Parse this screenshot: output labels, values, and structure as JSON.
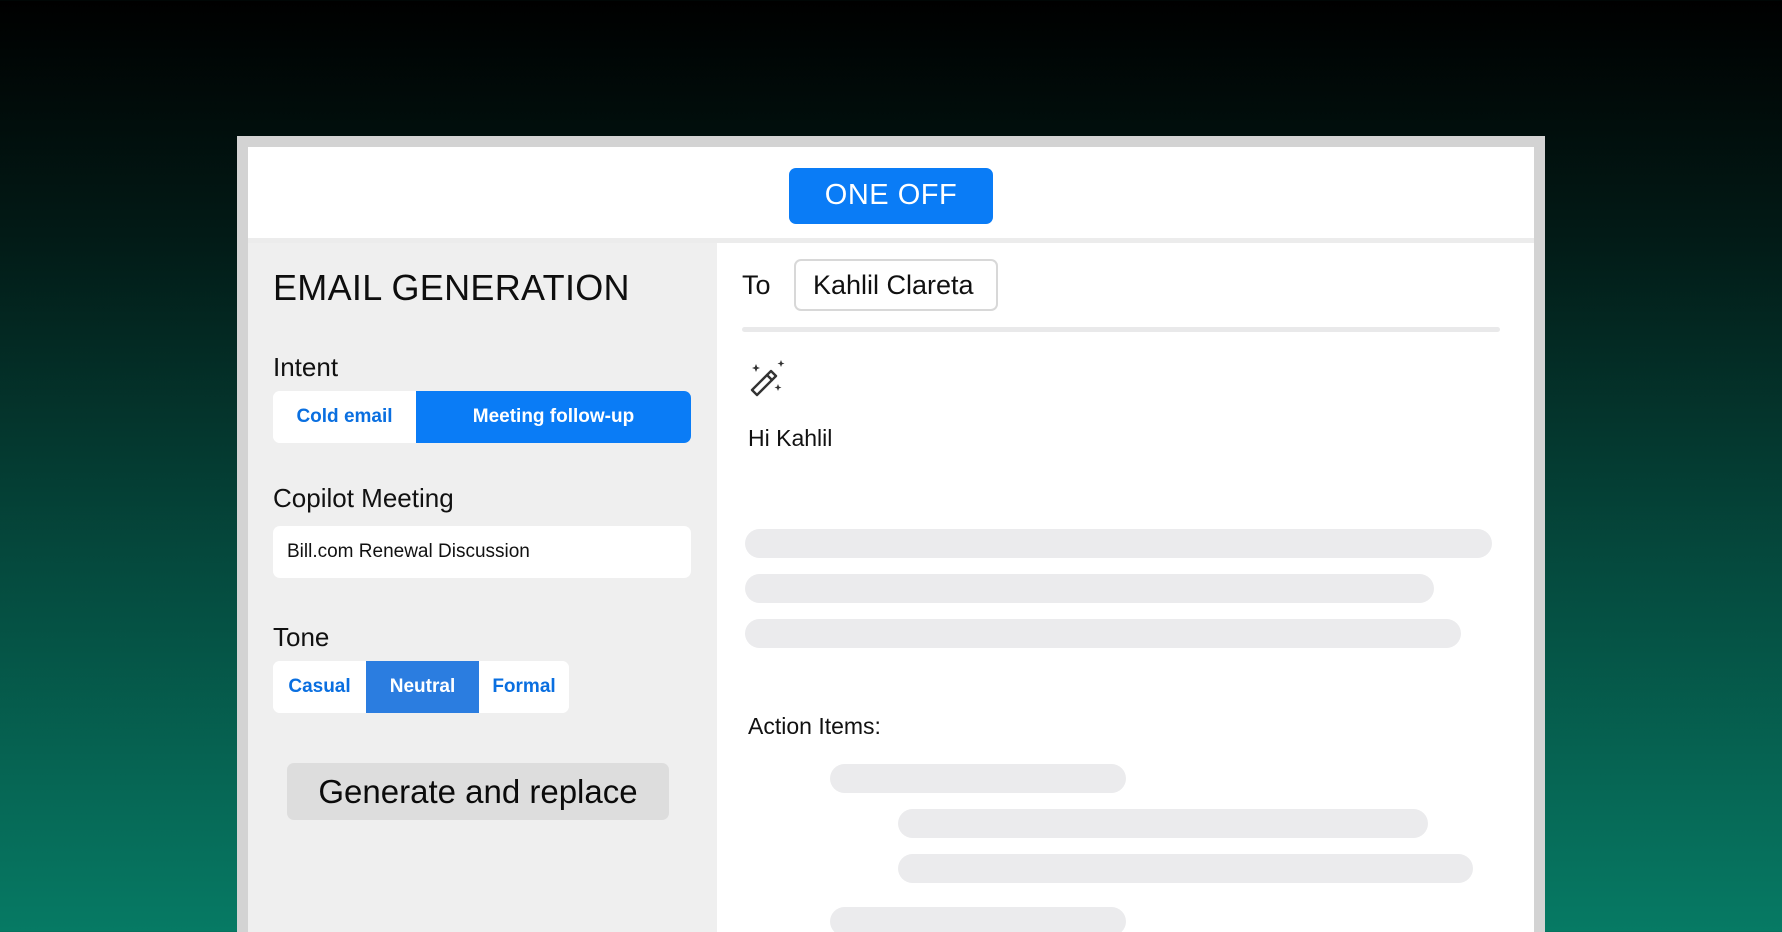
{
  "header": {
    "mode_label": "ONE OFF"
  },
  "left_panel": {
    "title": "EMAIL GENERATION",
    "intent": {
      "label": "Intent",
      "options": [
        "Cold email",
        "Meeting follow-up"
      ],
      "selected": "Meeting follow-up"
    },
    "meeting": {
      "label": "Copilot Meeting",
      "value": "Bill.com Renewal Discussion"
    },
    "tone": {
      "label": "Tone",
      "options": [
        "Casual",
        "Neutral",
        "Formal"
      ],
      "selected": "Neutral"
    },
    "generate_button": "Generate and replace"
  },
  "right_panel": {
    "to_label": "To",
    "to_value": "Kahlil Clareta",
    "icon": "magic-wand-icon",
    "greeting": "Hi Kahlil",
    "action_items_label": "Action Items:"
  },
  "colors": {
    "accent": "#0a7cf6",
    "panel_bg": "#efefef",
    "skeleton": "#ebebed"
  }
}
